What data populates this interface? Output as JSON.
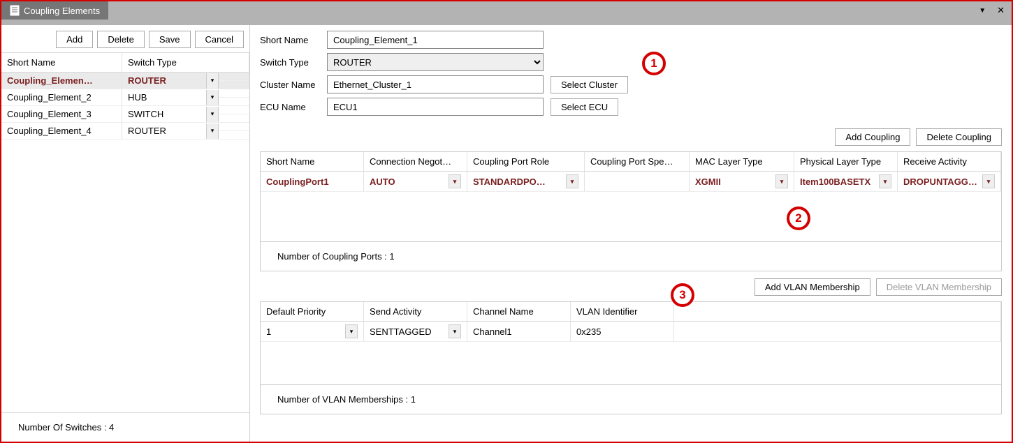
{
  "window": {
    "title": "Coupling Elements"
  },
  "left": {
    "toolbar": {
      "add": "Add",
      "delete": "Delete",
      "save": "Save",
      "cancel": "Cancel"
    },
    "headers": {
      "short_name": "Short Name",
      "switch_type": "Switch Type"
    },
    "rows": [
      {
        "name": "Coupling_Elemen…",
        "type": "ROUTER",
        "selected": true
      },
      {
        "name": "Coupling_Element_2",
        "type": "HUB",
        "selected": false
      },
      {
        "name": "Coupling_Element_3",
        "type": "SWITCH",
        "selected": false
      },
      {
        "name": "Coupling_Element_4",
        "type": "ROUTER",
        "selected": false
      }
    ],
    "footer": "Number Of Switches : 4"
  },
  "form": {
    "short_name_label": "Short Name",
    "short_name_value": "Coupling_Element_1",
    "switch_type_label": "Switch Type",
    "switch_type_value": "ROUTER",
    "cluster_label": "Cluster Name",
    "cluster_value": "Ethernet_Cluster_1",
    "select_cluster": "Select Cluster",
    "ecu_label": "ECU Name",
    "ecu_value": "ECU1",
    "select_ecu": "Select ECU"
  },
  "coupling": {
    "add": "Add Coupling",
    "delete": "Delete Coupling",
    "headers": {
      "short_name": "Short Name",
      "conn_negot": "Connection Negot…",
      "port_role": "Coupling Port Role",
      "port_speed": "Coupling Port Spe…",
      "mac_layer": "MAC Layer Type",
      "phys_layer": "Physical Layer Type",
      "recv_act": "Receive Activity"
    },
    "row": {
      "short_name": "CouplingPort1",
      "conn_negot": "AUTO",
      "port_role": "STANDARDPO…",
      "port_speed": "",
      "mac_layer": "XGMII",
      "phys_layer": "Item100BASETX",
      "recv_act": "DROPUNTAGG…"
    },
    "status": "Number of Coupling Ports : 1"
  },
  "vlan": {
    "add": "Add VLAN Membership",
    "delete": "Delete VLAN Membership",
    "headers": {
      "def_prio": "Default Priority",
      "send_act": "Send Activity",
      "chan_name": "Channel Name",
      "vlan_id": "VLAN Identifier"
    },
    "row": {
      "def_prio": "1",
      "send_act": "SENTTAGGED",
      "chan_name": "Channel1",
      "vlan_id": "0x235"
    },
    "status": "Number of VLAN Memberships : 1"
  },
  "annotations": {
    "a1": "1",
    "a2": "2",
    "a3": "3"
  }
}
